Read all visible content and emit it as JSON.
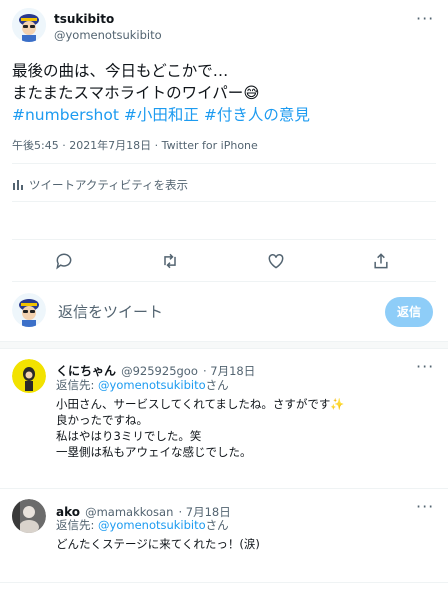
{
  "tweet": {
    "name": "tsukibito",
    "handle": "@yomenotsukibito",
    "more": "···",
    "line1": "最後の曲は、今日もどこかで…",
    "line2": "またまたスマホライトのワイパー",
    "line2_emoji": "😅",
    "hashtags": [
      "#numbershot",
      "#小田和正",
      "#付き人の意見"
    ],
    "timestamp": "午後5:45 · 2021年7月18日 · Twitter for iPhone",
    "analytics_label": "ツイートアクティビティを表示"
  },
  "reply_box": {
    "placeholder": "返信をツイート",
    "button_label": "返信"
  },
  "replies": [
    {
      "name": "くにちゃん",
      "handle": "@925925goo",
      "date": "· 7月18日",
      "reply_to_prefix": "返信先: ",
      "reply_to_handle": "@yomenotsukibito",
      "reply_to_suffix": "さん",
      "lines": [
        "小田さん、サービスしてくれてましたね。さすがです✨",
        "良かったですね。",
        "私はやはり3ミリでした。笑",
        "一塁側は私もアウェイな感じでした。"
      ]
    },
    {
      "name": "ako",
      "handle": "@mamakkosan",
      "date": "· 7月18日",
      "reply_to_prefix": "返信先: ",
      "reply_to_handle": "@yomenotsukibito",
      "reply_to_suffix": "さん",
      "lines": [
        "どんたくステージに来てくれたっ！(涙)"
      ]
    }
  ],
  "colors": {
    "accent": "#1d9bf0",
    "reply_button": "#8ecdf8",
    "muted": "#536471"
  },
  "icons": [
    "analytics-icon",
    "reply-icon",
    "retweet-icon",
    "like-icon",
    "share-icon",
    "more-icon"
  ]
}
